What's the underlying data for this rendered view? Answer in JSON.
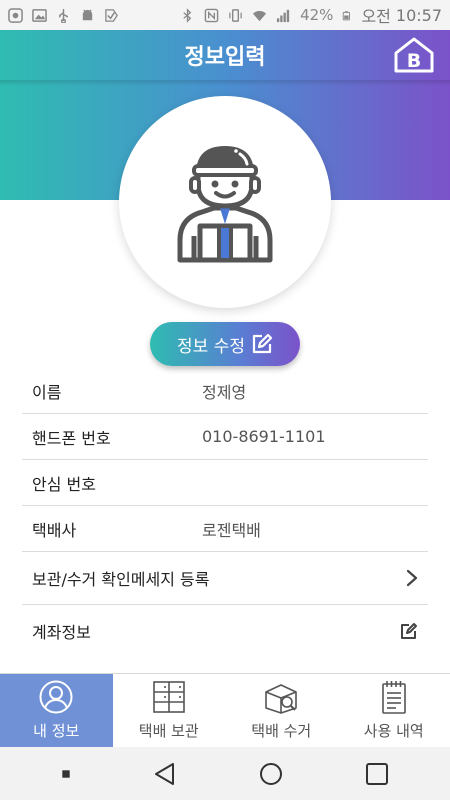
{
  "status_bar": {
    "battery": "42%",
    "period": "오전",
    "time": "10:57"
  },
  "header": {
    "title": "정보입력"
  },
  "profile": {
    "edit_button_label": "정보 수정"
  },
  "info": {
    "rows": [
      {
        "label": "이름",
        "value": "정제영"
      },
      {
        "label": "핸드폰 번호",
        "value": "010-8691-1101"
      },
      {
        "label": "안심 번호",
        "value": ""
      },
      {
        "label": "택배사",
        "value": "로젠택배"
      },
      {
        "label": "보관/수거 확인메세지 등록",
        "value": ""
      },
      {
        "label": "계좌정보",
        "value": ""
      }
    ]
  },
  "bottom_nav": {
    "items": [
      {
        "label": "내 정보",
        "active": true
      },
      {
        "label": "택배 보관",
        "active": false
      },
      {
        "label": "택배 수거",
        "active": false
      },
      {
        "label": "사용 내역",
        "active": false
      }
    ]
  },
  "colors": {
    "gradient_start": "#2fbcb1",
    "gradient_end": "#7b52c9",
    "nav_active": "#7091d6"
  }
}
